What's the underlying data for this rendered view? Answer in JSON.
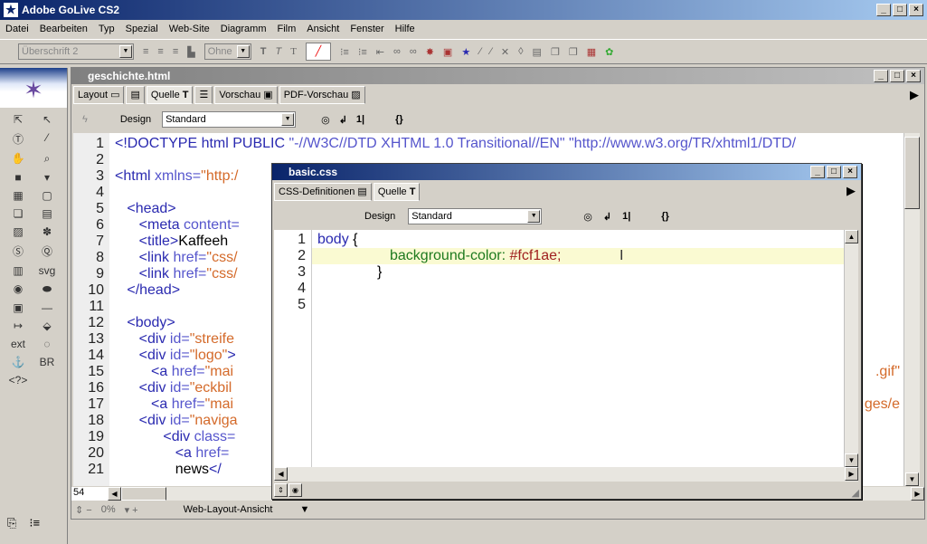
{
  "app": {
    "title": "Adobe GoLive CS2"
  },
  "menu": [
    "Datei",
    "Bearbeiten",
    "Typ",
    "Spezial",
    "Web-Site",
    "Diagramm",
    "Film",
    "Ansicht",
    "Fenster",
    "Hilfe"
  ],
  "toolbar": {
    "paragraph_format": "Überschrift 2",
    "font_set": "Ohne"
  },
  "doc": {
    "title": "geschichte.html",
    "tabs": [
      "Layout",
      "Quelle",
      "Vorschau",
      "PDF-Vorschau"
    ],
    "design_label": "Design",
    "design_value": "Standard",
    "lines": [
      {
        "n": "1",
        "html": "<span class='tg'>&lt;!DOCTYPE html PUBLIC </span><span class='at'>\"-//W3C//DTD XHTML 1.0 Transitional//EN\" \"http://www.w3.org/TR/xhtml1/DTD/</span>"
      },
      {
        "n": "2",
        "html": ""
      },
      {
        "n": "3",
        "html": "<span class='tg'>&lt;html </span><span class='at'>xmlns=</span><span class='vl'>\"http:/</span>"
      },
      {
        "n": "4",
        "html": ""
      },
      {
        "n": "5",
        "html": "&nbsp;&nbsp;&nbsp;<span class='tg'>&lt;head&gt;</span>"
      },
      {
        "n": "6",
        "html": "&nbsp;&nbsp;&nbsp;&nbsp;&nbsp;&nbsp;<span class='tg'>&lt;meta </span><span class='at'>content=</span>"
      },
      {
        "n": "7",
        "html": "&nbsp;&nbsp;&nbsp;&nbsp;&nbsp;&nbsp;<span class='tg'>&lt;title&gt;</span><span class='tx'>Kaffeeh</span>"
      },
      {
        "n": "8",
        "html": "&nbsp;&nbsp;&nbsp;&nbsp;&nbsp;&nbsp;<span class='tg'>&lt;link </span><span class='at'>href=</span><span class='vl'>\"css/</span>"
      },
      {
        "n": "9",
        "html": "&nbsp;&nbsp;&nbsp;&nbsp;&nbsp;&nbsp;<span class='tg'>&lt;link </span><span class='at'>href=</span><span class='vl'>\"css/</span>"
      },
      {
        "n": "10",
        "html": "&nbsp;&nbsp;&nbsp;<span class='tg'>&lt;/head&gt;</span>"
      },
      {
        "n": "11",
        "html": ""
      },
      {
        "n": "12",
        "html": "&nbsp;&nbsp;&nbsp;<span class='tg'>&lt;body&gt;</span>"
      },
      {
        "n": "13",
        "html": "&nbsp;&nbsp;&nbsp;&nbsp;&nbsp;&nbsp;<span class='tg'>&lt;div </span><span class='at'>id=</span><span class='vl'>\"streife</span>"
      },
      {
        "n": "14",
        "html": "&nbsp;&nbsp;&nbsp;&nbsp;&nbsp;&nbsp;<span class='tg'>&lt;div </span><span class='at'>id=</span><span class='vl'>\"logo\"</span><span class='tg'>&gt;</span>"
      },
      {
        "n": "15",
        "html": "&nbsp;&nbsp;&nbsp;&nbsp;&nbsp;&nbsp;&nbsp;&nbsp;&nbsp;<span class='tg'>&lt;a </span><span class='at'>href=</span><span class='vl'>\"mai</span>"
      },
      {
        "n": "16",
        "html": "&nbsp;&nbsp;&nbsp;&nbsp;&nbsp;&nbsp;<span class='tg'>&lt;div </span><span class='at'>id=</span><span class='vl'>\"eckbil</span>"
      },
      {
        "n": "17",
        "html": "&nbsp;&nbsp;&nbsp;&nbsp;&nbsp;&nbsp;&nbsp;&nbsp;&nbsp;<span class='tg'>&lt;a </span><span class='at'>href=</span><span class='vl'>\"mai</span>"
      },
      {
        "n": "18",
        "html": "&nbsp;&nbsp;&nbsp;&nbsp;&nbsp;&nbsp;<span class='tg'>&lt;div </span><span class='at'>id=</span><span class='vl'>\"naviga</span>"
      },
      {
        "n": "19",
        "html": "&nbsp;&nbsp;&nbsp;&nbsp;&nbsp;&nbsp;&nbsp;&nbsp;&nbsp;&nbsp;&nbsp;&nbsp;<span class='tg'>&lt;div </span><span class='at'>class=</span>"
      },
      {
        "n": "20",
        "html": "&nbsp;&nbsp;&nbsp;&nbsp;&nbsp;&nbsp;&nbsp;&nbsp;&nbsp;&nbsp;&nbsp;&nbsp;&nbsp;&nbsp;&nbsp;<span class='tg'>&lt;a </span><span class='at'>href=</span>"
      },
      {
        "n": "21",
        "html": "&nbsp;&nbsp;&nbsp;&nbsp;&nbsp;&nbsp;&nbsp;&nbsp;&nbsp;&nbsp;&nbsp;&nbsp;&nbsp;&nbsp;&nbsp;<span class='tx'>news</span><span class='tg'>&lt;/</span>"
      }
    ],
    "right_fragments": {
      "line15": ".gif\"",
      "line17": "ges/e"
    },
    "line_field": "54",
    "status": {
      "zoom": "0%",
      "view": "Web-Layout-Ansicht"
    }
  },
  "css": {
    "title": "basic.css",
    "tabs": [
      "CSS-Definitionen",
      "Quelle"
    ],
    "design_label": "Design",
    "design_value": "Standard",
    "line_numbers": [
      "1",
      "2",
      "3",
      "4",
      "5"
    ],
    "selector": "body",
    "open_brace": "{",
    "property": "background-color:",
    "value": "#fcf1ae;",
    "close_brace": "}"
  },
  "colors": {
    "title_active": "#0a246a",
    "current_line": "#fafad2"
  }
}
